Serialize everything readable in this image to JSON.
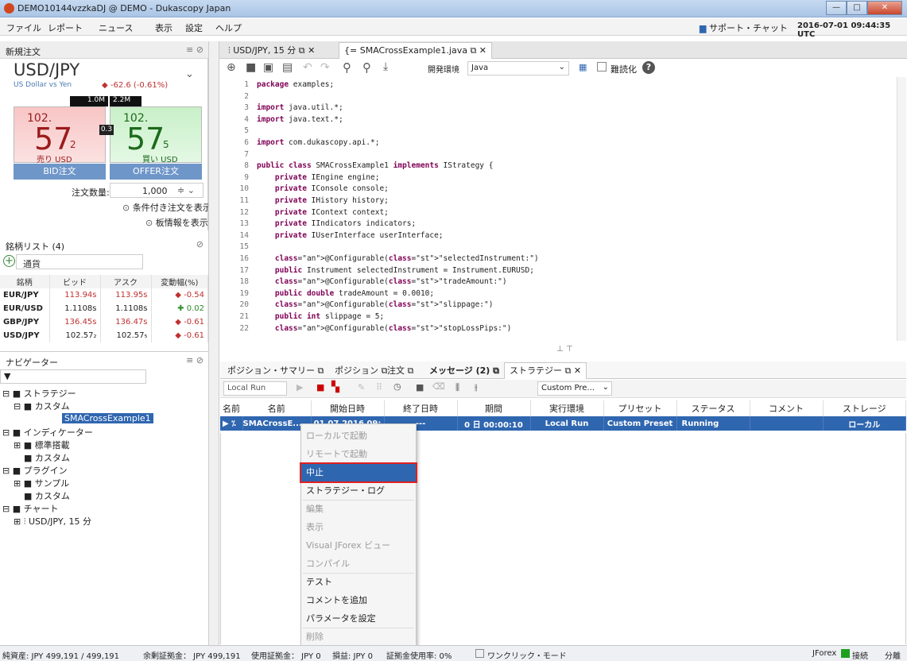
{
  "window": {
    "title": "DEMO10144vzzkaDJ @ DEMO - Dukascopy Japan"
  },
  "menu": {
    "items": [
      "ファイル",
      "レポート",
      "ニュース",
      "表示",
      "設定",
      "ヘルプ"
    ],
    "support": "サポート・チャット",
    "datetime": "2016-07-01 09:44:35 UTC"
  },
  "new_order": {
    "header": "新規注文",
    "instrument": "USD/JPY",
    "instrument_desc": "US Dollar vs Yen",
    "change": "◆ -62.6 (-0.61%)",
    "bid_vol": "1.0M",
    "ask_vol": "2.2M",
    "bid_big": "102.",
    "bid_main": "57",
    "bid_sub": "2",
    "bid_label": "売り USD",
    "ask_big": "102.",
    "ask_main": "57",
    "ask_sub": "5",
    "ask_label": "買い USD",
    "spread": "0.3",
    "bid_button": "BID注文",
    "offer_button": "OFFER注文",
    "qty_label": "注文数量:",
    "qty_value": "1,000",
    "cond_link": "条件付き注文を表示",
    "book_link": "板情報を表示"
  },
  "watchlist": {
    "header": "銘柄リスト (4)",
    "search_placeholder": "通貨",
    "columns": [
      "銘柄",
      "ビッド",
      "アスク",
      "変動幅(%)"
    ],
    "rows": [
      {
        "sym": "EUR/JPY",
        "bid": "113.94s",
        "ask": "113.95s",
        "chg": "◆ -0.54"
      },
      {
        "sym": "EUR/USD",
        "bid": "1.1108s",
        "ask": "1.1108s",
        "chg": "✚ 0.02"
      },
      {
        "sym": "GBP/JPY",
        "bid": "136.45s",
        "ask": "136.47s",
        "chg": "◆ -0.61"
      },
      {
        "sym": "USD/JPY",
        "bid": "102.57₂",
        "ask": "102.57₅",
        "chg": "◆ -0.61"
      }
    ]
  },
  "navigator": {
    "header": "ナビゲーター",
    "nodes": [
      "ストラテジー",
      "カスタム",
      "SMACrossExample1",
      "インディケーター",
      "標準搭載",
      "カスタム",
      "プラグイン",
      "サンプル",
      "カスタム",
      "チャート",
      "USD/JPY, 15 分"
    ]
  },
  "editor": {
    "tabs": [
      "USD/JPY, 15 分",
      "SMACrossExample1.java"
    ],
    "env_label": "開発環境",
    "env_value": "Java",
    "readonly_label": "難読化",
    "lines": [
      {
        "n": "1",
        "t": "package examples;"
      },
      {
        "n": "2",
        "t": ""
      },
      {
        "n": "3",
        "t": "import java.util.*;"
      },
      {
        "n": "4",
        "t": "import java.text.*;"
      },
      {
        "n": "5",
        "t": ""
      },
      {
        "n": "6",
        "t": "import com.dukascopy.api.*;"
      },
      {
        "n": "7",
        "t": ""
      },
      {
        "n": "8",
        "t": "public class SMACrossExample1 implements IStrategy {"
      },
      {
        "n": "9",
        "t": "    private IEngine engine;"
      },
      {
        "n": "10",
        "t": "    private IConsole console;"
      },
      {
        "n": "11",
        "t": "    private IHistory history;"
      },
      {
        "n": "12",
        "t": "    private IContext context;"
      },
      {
        "n": "13",
        "t": "    private IIndicators indicators;"
      },
      {
        "n": "14",
        "t": "    private IUserInterface userInterface;"
      },
      {
        "n": "15",
        "t": ""
      },
      {
        "n": "16",
        "t": "    @Configurable(\"selectedInstrument:\")"
      },
      {
        "n": "17",
        "t": "    public Instrument selectedInstrument = Instrument.EURUSD;"
      },
      {
        "n": "18",
        "t": "    @Configurable(\"tradeAmount:\")"
      },
      {
        "n": "19",
        "t": "    public double tradeAmount = 0.0010;"
      },
      {
        "n": "20",
        "t": "    @Configurable(\"slippage:\")"
      },
      {
        "n": "21",
        "t": "    public int slippage = 5;"
      },
      {
        "n": "22",
        "t": "    @Configurable(\"stopLossPips:\")"
      }
    ]
  },
  "bottom": {
    "tabs": [
      "ポジション・サマリー",
      "ポジション",
      "注文",
      "メッセージ (2)",
      "ストラテジー"
    ],
    "run_mode": "Local Run",
    "preset": "Custom Pre...",
    "columns": [
      "名前",
      "開始日時",
      "終了日時",
      "期間",
      "実行環境",
      "プリセット",
      "ステータス",
      "コメント",
      "ストレージ"
    ],
    "row": {
      "name": "SMACrossE...",
      "start": "01.07.2016 09:",
      "end": "---",
      "dur": "0 日 00:00:10",
      "env": "Local Run",
      "preset": "Custom Preset",
      "status": "Running",
      "comment": "",
      "storage": "ローカル"
    }
  },
  "context_menu": {
    "items": [
      {
        "label": "ローカルで起動",
        "state": "dis"
      },
      {
        "label": "リモートで起動",
        "state": "dis"
      },
      {
        "label": "中止",
        "state": "hl"
      },
      {
        "label": "ストラテジー・ログ",
        "state": "en"
      },
      {
        "label": "編集",
        "state": "dis"
      },
      {
        "label": "表示",
        "state": "dis"
      },
      {
        "label": "Visual JForex ビュー",
        "state": "dis"
      },
      {
        "label": "コンパイル",
        "state": "dis"
      },
      {
        "label": "テスト",
        "state": "en"
      },
      {
        "label": "コメントを追加",
        "state": "en"
      },
      {
        "label": "パラメータを設定",
        "state": "en"
      },
      {
        "label": "削除",
        "state": "dis"
      }
    ]
  },
  "status": {
    "equity": "純資産: JPY 499,191 / 499,191",
    "free_margin": "余剰証拠金： JPY 499,191",
    "used_margin": "使用証拠金： JPY 0",
    "pnl": "損益: JPY 0",
    "margin_rate": "証拠金使用率: 0%",
    "oneclick": "ワンクリック・モード",
    "app": "JForex",
    "conn": "接続",
    "split": "分離"
  },
  "colors": {
    "accent": "#2f66b0",
    "highlight_border": "#e02020",
    "bid_red": "#9b1b1b",
    "ask_green": "#1c6a1c"
  }
}
